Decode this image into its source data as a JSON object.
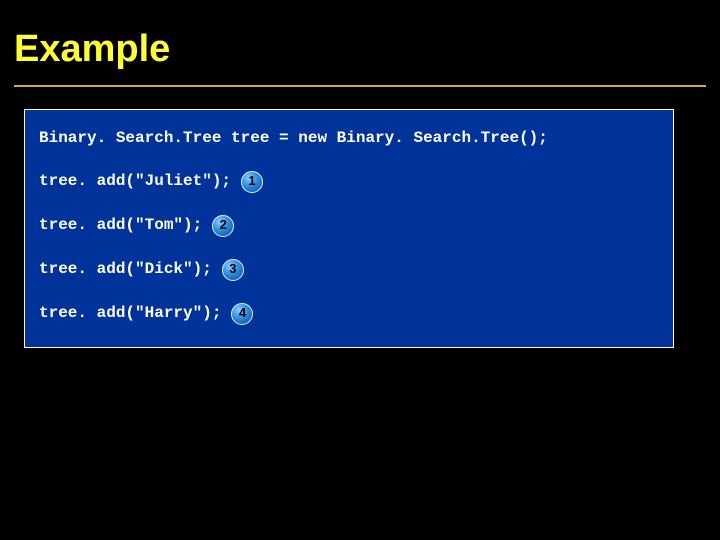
{
  "title": "Example",
  "code": {
    "line0": "Binary. Search.Tree tree = new Binary. Search.Tree();",
    "lines": [
      {
        "text": "tree. add(\"Juliet\");",
        "num": "1"
      },
      {
        "text": "tree. add(\"Tom\");",
        "num": "2"
      },
      {
        "text": "tree. add(\"Dick\");",
        "num": "3"
      },
      {
        "text": "tree. add(\"Harry\");",
        "num": "4"
      }
    ]
  }
}
